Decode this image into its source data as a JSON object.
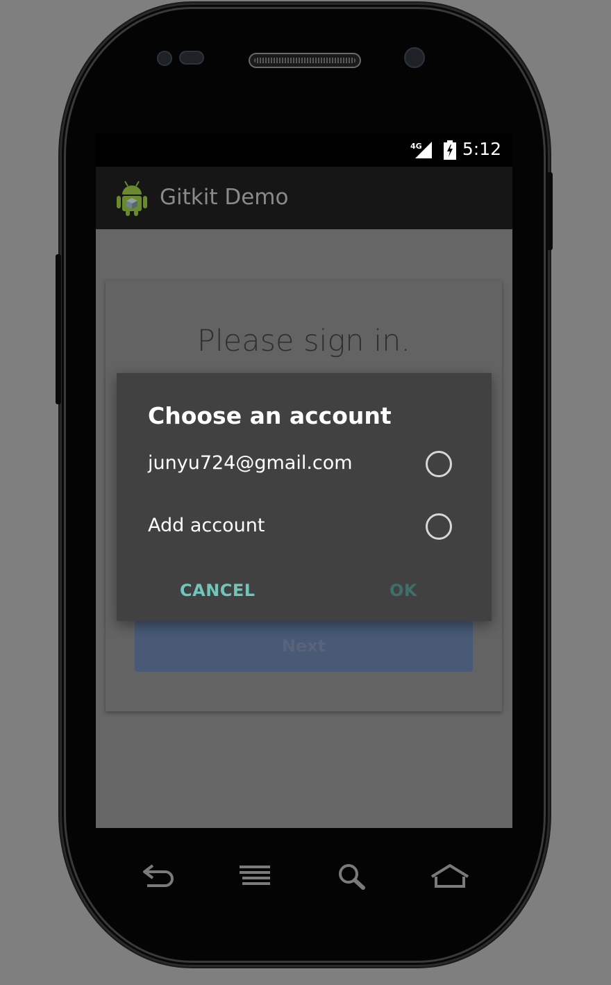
{
  "status_bar": {
    "network_label": "4G",
    "time": "5:12"
  },
  "app": {
    "title": "Gitkit Demo",
    "icon": "android-robot-icon"
  },
  "sign_in_card": {
    "title": "Please sign in.",
    "next_label": "Next"
  },
  "dialog": {
    "title": "Choose an account",
    "options": [
      {
        "label": "junyu724@gmail.com",
        "selected": false
      },
      {
        "label": "Add account",
        "selected": false
      }
    ],
    "cancel_label": "CANCEL",
    "ok_label": "OK"
  },
  "nav_bar": {
    "icons": [
      "back-icon",
      "menu-icon",
      "search-icon",
      "home-icon"
    ]
  },
  "colors": {
    "background": "#7f7f7f",
    "dialog": "#414141",
    "accent": "#71c6b9",
    "next_button": "#485a76"
  }
}
